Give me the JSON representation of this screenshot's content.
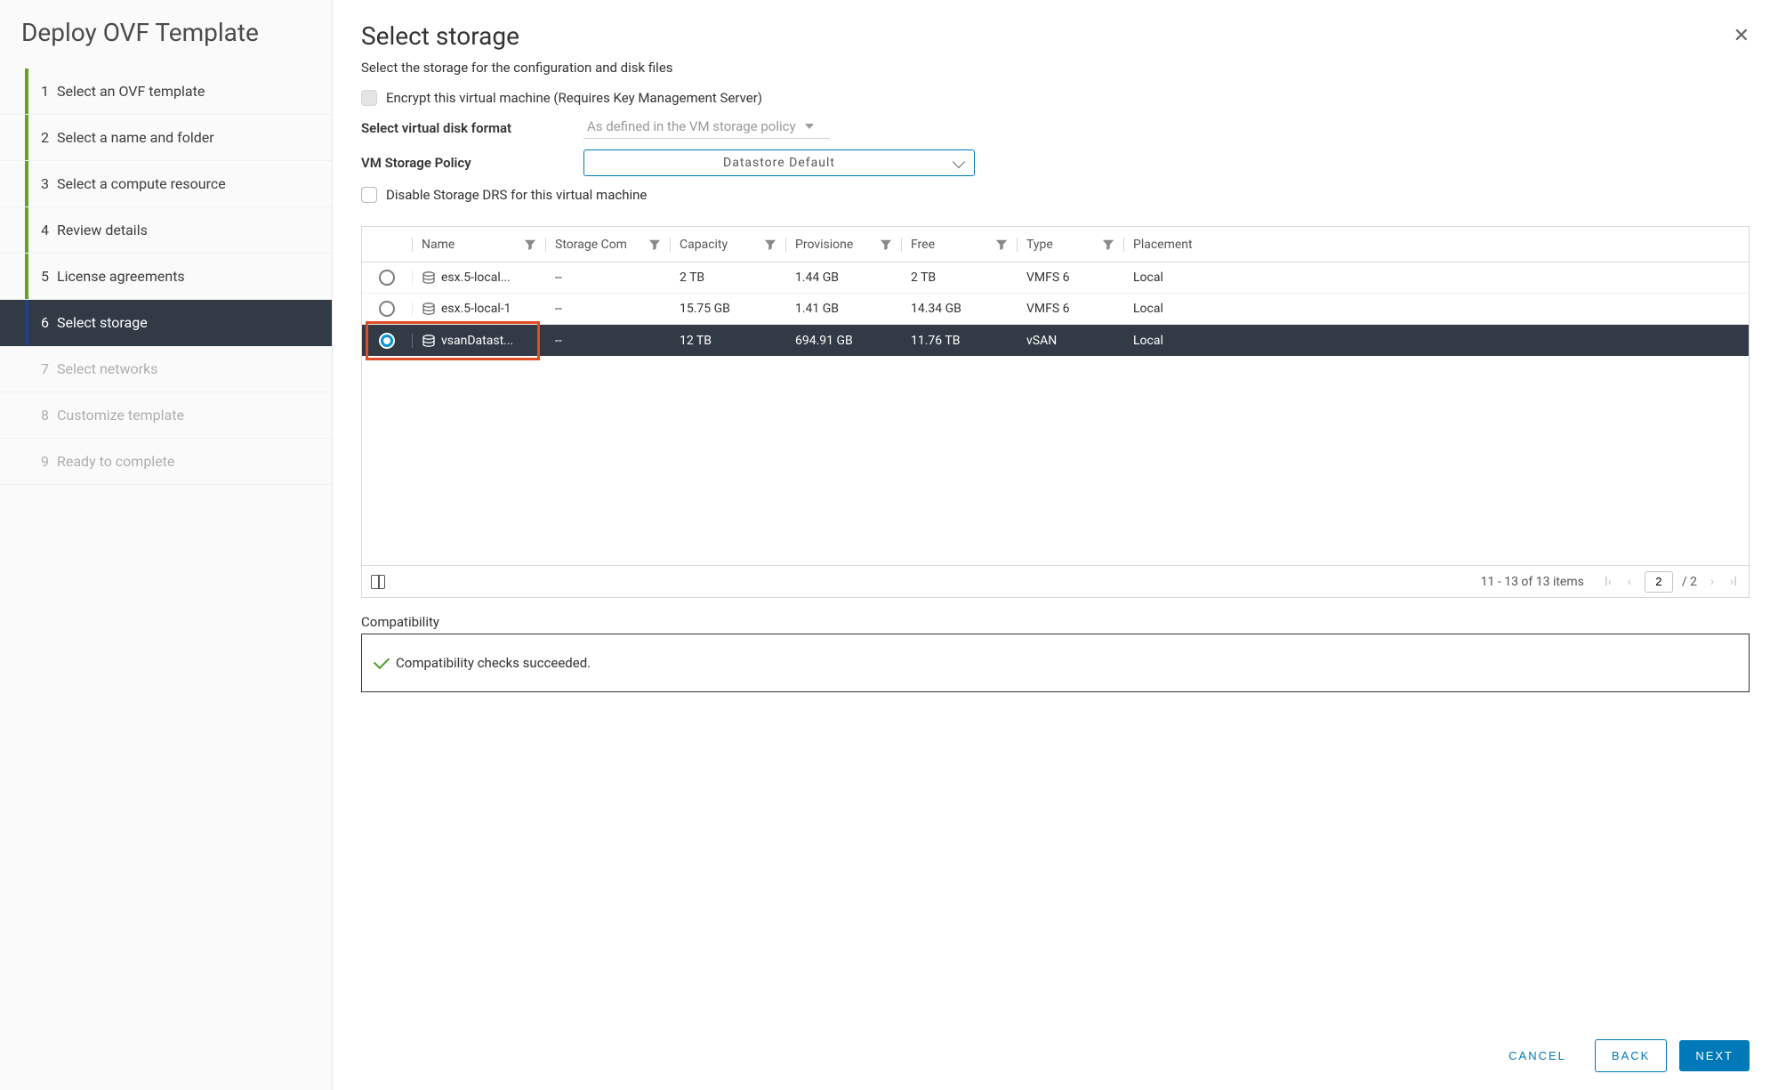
{
  "sidebar": {
    "title": "Deploy OVF Template",
    "steps": [
      {
        "num": "1",
        "label": "Select an OVF template",
        "state": "done"
      },
      {
        "num": "2",
        "label": "Select a name and folder",
        "state": "done"
      },
      {
        "num": "3",
        "label": "Select a compute resource",
        "state": "done"
      },
      {
        "num": "4",
        "label": "Review details",
        "state": "done"
      },
      {
        "num": "5",
        "label": "License agreements",
        "state": "done"
      },
      {
        "num": "6",
        "label": "Select storage",
        "state": "active"
      },
      {
        "num": "7",
        "label": "Select networks",
        "state": "disabled"
      },
      {
        "num": "8",
        "label": "Customize template",
        "state": "disabled"
      },
      {
        "num": "9",
        "label": "Ready to complete",
        "state": "disabled"
      }
    ]
  },
  "main": {
    "title": "Select storage",
    "subtitle": "Select the storage for the configuration and disk files",
    "encrypt_label": "Encrypt this virtual machine (Requires Key Management Server)",
    "disk_format_label": "Select virtual disk format",
    "disk_format_value": "As defined in the VM storage policy",
    "policy_label": "VM Storage Policy",
    "policy_value": "Datastore Default",
    "drs_label": "Disable Storage DRS for this virtual machine"
  },
  "table": {
    "columns": {
      "name": "Name",
      "storage_compat": "Storage Com",
      "capacity": "Capacity",
      "provisioned": "Provisione",
      "free": "Free",
      "type": "Type",
      "placement": "Placement"
    },
    "rows": [
      {
        "name": "esx.5-local...",
        "sc": "--",
        "cap": "2 TB",
        "prov": "1.44 GB",
        "free": "2 TB",
        "type": "VMFS 6",
        "place": "Local",
        "selected": false
      },
      {
        "name": "esx.5-local-1",
        "sc": "--",
        "cap": "15.75 GB",
        "prov": "1.41 GB",
        "free": "14.34 GB",
        "type": "VMFS 6",
        "place": "Local",
        "selected": false
      },
      {
        "name": "vsanDatast...",
        "sc": "--",
        "cap": "12 TB",
        "prov": "694.91 GB",
        "free": "11.76 TB",
        "type": "vSAN",
        "place": "Local",
        "selected": true
      }
    ],
    "footer": {
      "range": "11 - 13 of 13 items",
      "page": "2",
      "total_pages": "/ 2"
    }
  },
  "compat": {
    "label": "Compatibility",
    "text": "Compatibility checks succeeded."
  },
  "buttons": {
    "cancel": "CANCEL",
    "back": "BACK",
    "next": "NEXT"
  }
}
